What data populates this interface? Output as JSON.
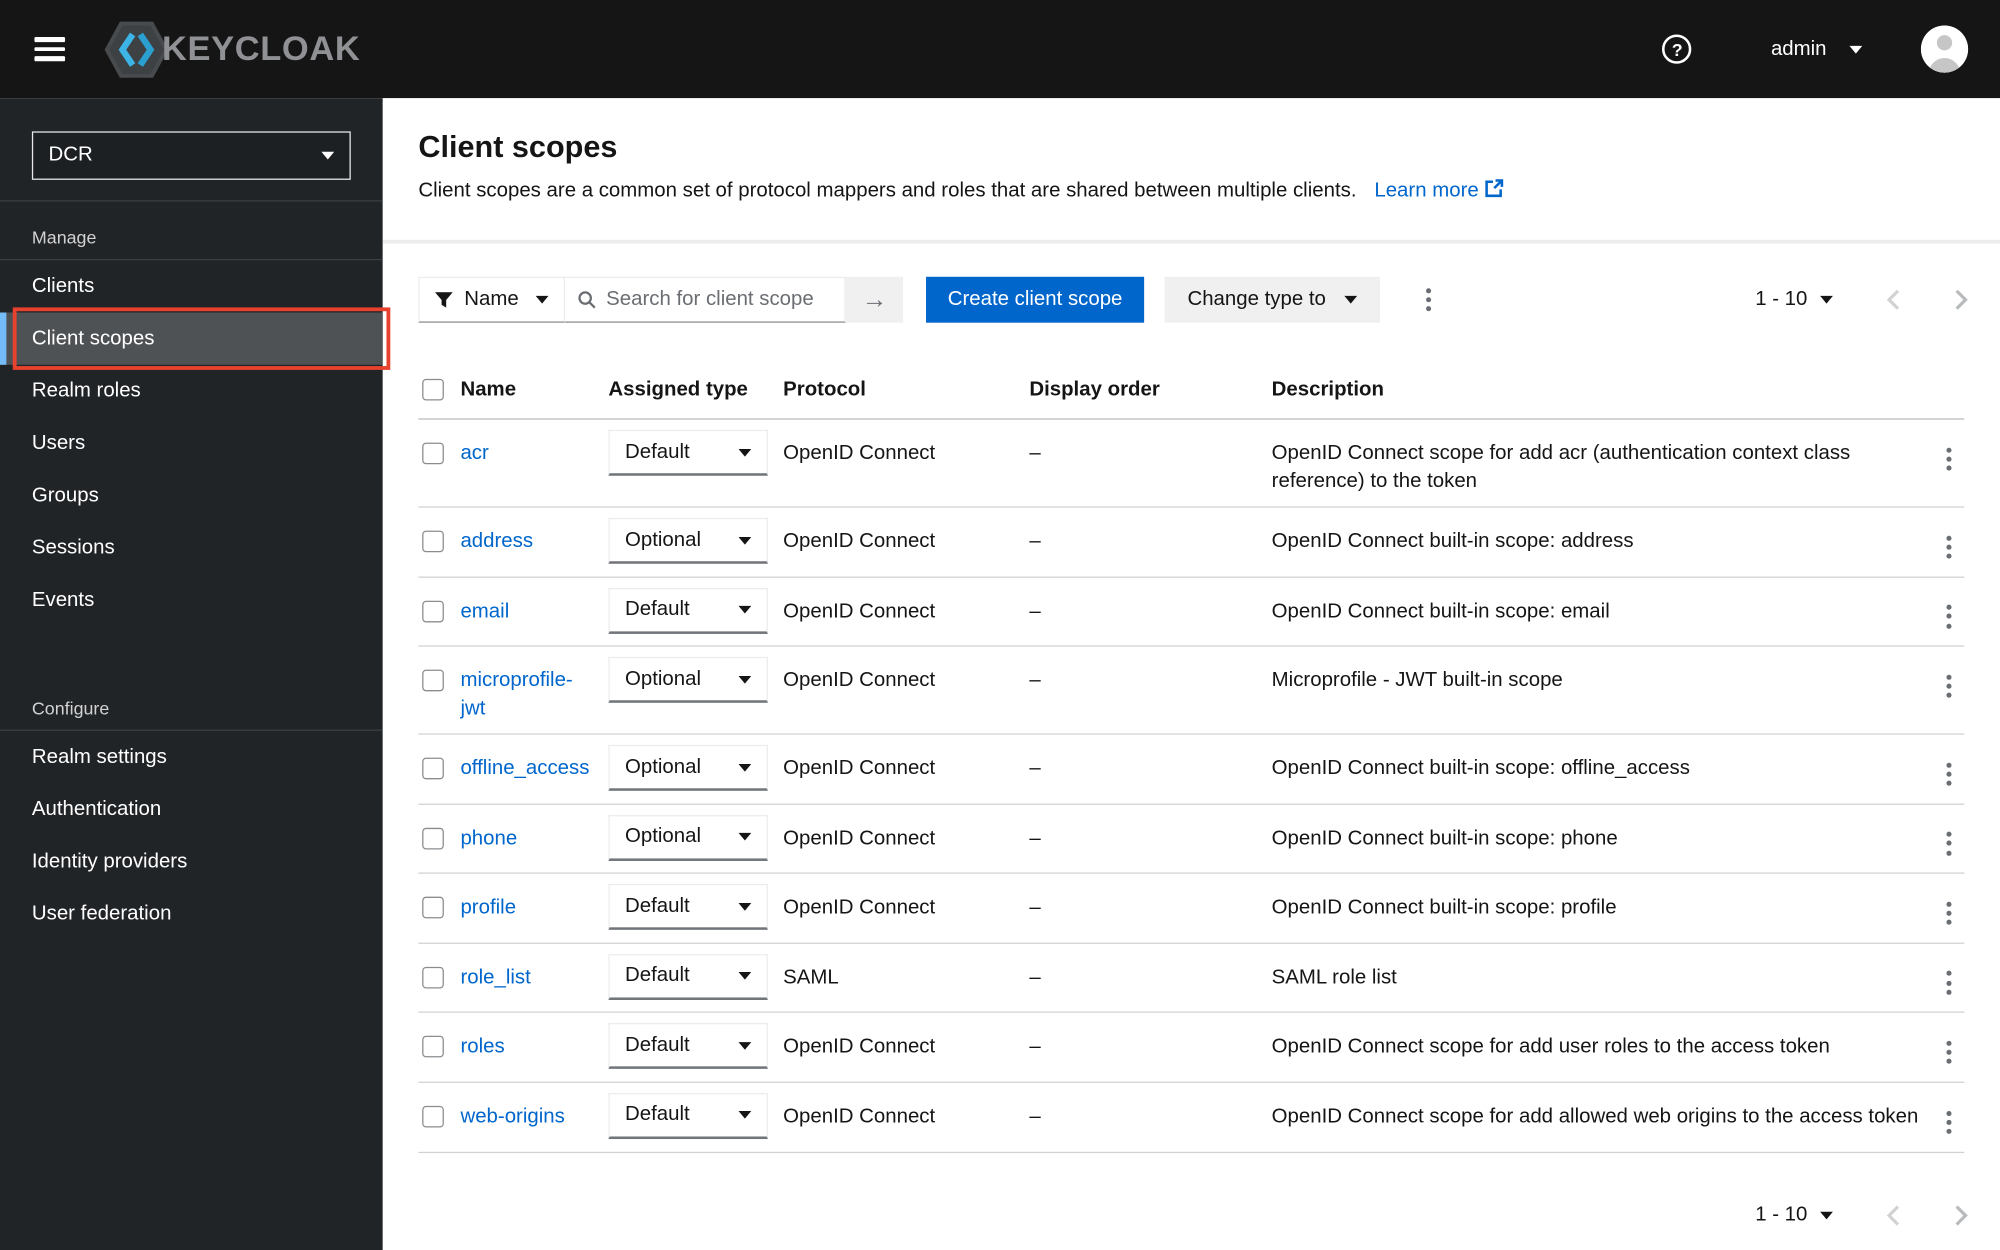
{
  "masthead": {
    "brand": "KEYCLOAK",
    "user_menu": "admin"
  },
  "icons": {
    "hamburger": "hamburger-icon",
    "help": "?",
    "search_submit": "→",
    "filter": "funnel-icon",
    "search": "magnifier-icon",
    "kebab": "kebab-icon",
    "external_link": "external-link-icon"
  },
  "sidebar": {
    "realm_selector": "DCR",
    "selected_item": "Client scopes",
    "sections": [
      {
        "label": "Manage",
        "items": [
          "Clients",
          "Client scopes",
          "Realm roles",
          "Users",
          "Groups",
          "Sessions",
          "Events"
        ]
      },
      {
        "label": "Configure",
        "items": [
          "Realm settings",
          "Authentication",
          "Identity providers",
          "User federation"
        ]
      }
    ]
  },
  "page": {
    "title": "Client scopes",
    "description": "Client scopes are a common set of protocol mappers and roles that are shared between multiple clients.",
    "learn_more": "Learn more"
  },
  "toolbar": {
    "filter_label": "Name",
    "search_placeholder": "Search for client scope",
    "create_button": "Create client scope",
    "change_type_button": "Change type to"
  },
  "pagination": {
    "range": "1 - 10"
  },
  "table": {
    "headers": [
      "Name",
      "Assigned type",
      "Protocol",
      "Display order",
      "Description"
    ],
    "rows": [
      {
        "name": "acr",
        "assigned_type": "Default",
        "protocol": "OpenID Connect",
        "display_order": "–",
        "description": "OpenID Connect scope for add acr (authentication context class reference) to the token"
      },
      {
        "name": "address",
        "assigned_type": "Optional",
        "protocol": "OpenID Connect",
        "display_order": "–",
        "description": "OpenID Connect built-in scope: address"
      },
      {
        "name": "email",
        "assigned_type": "Default",
        "protocol": "OpenID Connect",
        "display_order": "–",
        "description": "OpenID Connect built-in scope: email"
      },
      {
        "name": "microprofile-jwt",
        "assigned_type": "Optional",
        "protocol": "OpenID Connect",
        "display_order": "–",
        "description": "Microprofile - JWT built-in scope"
      },
      {
        "name": "offline_access",
        "assigned_type": "Optional",
        "protocol": "OpenID Connect",
        "display_order": "–",
        "description": "OpenID Connect built-in scope: offline_access"
      },
      {
        "name": "phone",
        "assigned_type": "Optional",
        "protocol": "OpenID Connect",
        "display_order": "–",
        "description": "OpenID Connect built-in scope: phone"
      },
      {
        "name": "profile",
        "assigned_type": "Default",
        "protocol": "OpenID Connect",
        "display_order": "–",
        "description": "OpenID Connect built-in scope: profile"
      },
      {
        "name": "role_list",
        "assigned_type": "Default",
        "protocol": "SAML",
        "display_order": "–",
        "description": "SAML role list"
      },
      {
        "name": "roles",
        "assigned_type": "Default",
        "protocol": "OpenID Connect",
        "display_order": "–",
        "description": "OpenID Connect scope for add user roles to the access token"
      },
      {
        "name": "web-origins",
        "assigned_type": "Default",
        "protocol": "OpenID Connect",
        "display_order": "–",
        "description": "OpenID Connect scope for add allowed web origins to the access token"
      }
    ]
  },
  "colors": {
    "masthead_bg": "#151515",
    "sidebar_bg": "#212427",
    "selected_nav_bg": "#4f5255",
    "selected_nav_accent": "#73bcf7",
    "annotation_red": "#e8412d",
    "primary_blue": "#0066cc",
    "link_blue": "#0066cc",
    "logo_blue": "#3cb4e5"
  }
}
